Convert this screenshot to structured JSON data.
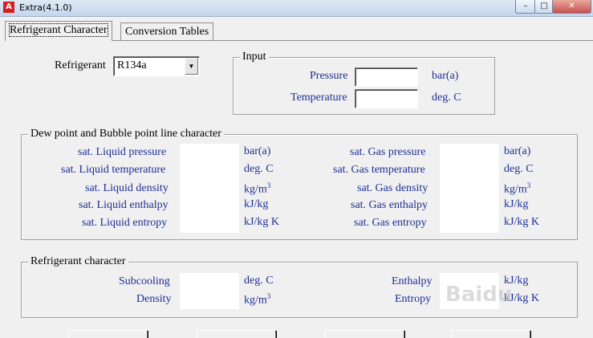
{
  "window": {
    "title": "Extra(4.1.0)",
    "icon": "app-logo-icon",
    "controls": {
      "minimize": "–",
      "maximize": "□",
      "close": "✕"
    }
  },
  "tabs": [
    {
      "label": "Refrigerant Character",
      "active": true
    },
    {
      "label": "Conversion Tables",
      "active": false
    }
  ],
  "refrigerant": {
    "label": "Refrigerant",
    "value": "R134a"
  },
  "input": {
    "title": "Input",
    "pressure_label": "Pressure",
    "pressure_unit": "bar(a)",
    "pressure_value": "",
    "temperature_label": "Temperature",
    "temperature_unit": "deg. C",
    "temperature_value": ""
  },
  "dew_bubble": {
    "title": "Dew point and Bubble point line character",
    "liquid": [
      {
        "label": "sat. Liquid pressure",
        "unit": "bar(a)",
        "value": ""
      },
      {
        "label": "sat. Liquid temperature",
        "unit": "deg. C",
        "value": ""
      },
      {
        "label": "sat. Liquid density",
        "unit": "kg/m",
        "unit_sup": "3",
        "value": ""
      },
      {
        "label": "sat. Liquid enthalpy",
        "unit": "kJ/kg",
        "value": ""
      },
      {
        "label": "sat. Liquid entropy",
        "unit": "kJ/kg K",
        "value": ""
      }
    ],
    "gas": [
      {
        "label": "sat. Gas pressure",
        "unit": "bar(a)",
        "value": ""
      },
      {
        "label": "sat. Gas temperature",
        "unit": "deg. C",
        "value": ""
      },
      {
        "label": "sat. Gas density",
        "unit": "kg/m",
        "unit_sup": "3",
        "value": ""
      },
      {
        "label": "sat. Gas enthalpy",
        "unit": "kJ/kg",
        "value": ""
      },
      {
        "label": "sat. Gas entropy",
        "unit": "kJ/kg K",
        "value": ""
      }
    ]
  },
  "ref_char": {
    "title": "Refrigerant character",
    "subcooling_label": "Subcooling",
    "subcooling_unit": "deg. C",
    "density_label": "Density",
    "density_unit": "kg/m",
    "density_unit_sup": "3",
    "enthalpy_label": "Enthalpy",
    "enthalpy_unit": "kJ/kg",
    "entropy_label": "Entropy",
    "entropy_unit": "kJ/kg K"
  },
  "watermark": "Baidu"
}
